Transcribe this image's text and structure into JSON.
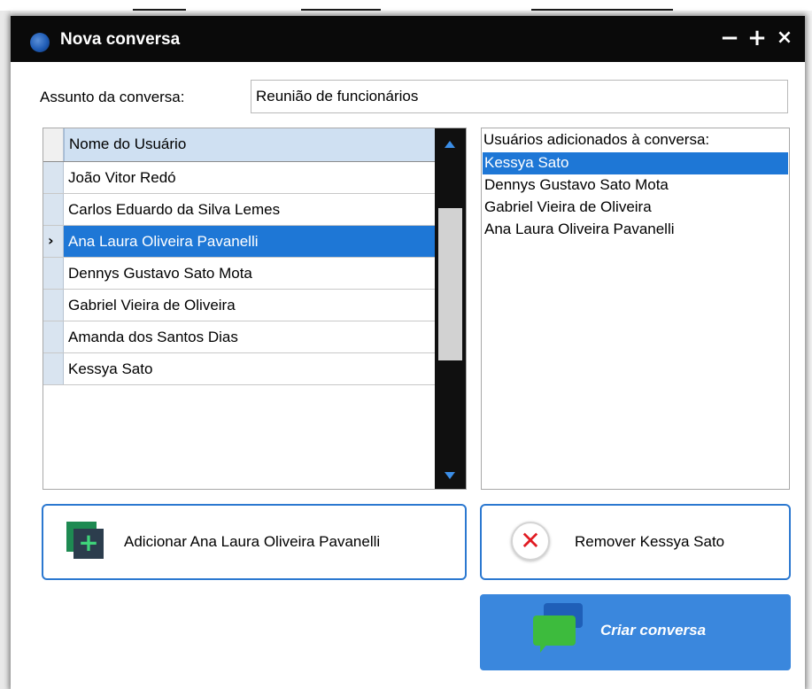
{
  "window": {
    "title": "Nova conversa",
    "controls": {
      "minimize": "−",
      "maximize": "+",
      "close": "×"
    }
  },
  "subject": {
    "label": "Assunto da conversa:",
    "value": "Reunião de funcionários"
  },
  "user_grid": {
    "column_header": "Nome do Usuário",
    "selected_index": 2,
    "rows": [
      "João Vitor Redó",
      "Carlos Eduardo da Silva Lemes",
      "Ana Laura Oliveira Pavanelli",
      "Dennys Gustavo Sato Mota",
      "Gabriel Vieira de Oliveira",
      "Amanda dos Santos Dias",
      "Kessya Sato"
    ],
    "current_row_marker": "›"
  },
  "added_users": {
    "header": "Usuários adicionados à conversa:",
    "selected_index": 0,
    "items": [
      "Kessya Sato",
      "Dennys Gustavo Sato Mota",
      "Gabriel Vieira de Oliveira",
      "Ana Laura Oliveira Pavanelli"
    ]
  },
  "buttons": {
    "add_label": "Adicionar Ana Laura Oliveira Pavanelli",
    "add_icon_glyph": "+",
    "remove_label": "Remover Kessya Sato",
    "remove_icon_glyph": "✕",
    "create_label": "Criar conversa"
  },
  "icons": {
    "app": "app-logo-icon",
    "add": "add-user-icon",
    "remove": "remove-x-icon",
    "create": "chat-bubbles-icon"
  },
  "colors": {
    "titlebar": "#0a0a0a",
    "selection": "#1e77d6",
    "accent_border": "#2b78d0",
    "create_button": "#3a87dd",
    "remove_x": "#e11b22",
    "grid_header": "#cfe0f2"
  }
}
